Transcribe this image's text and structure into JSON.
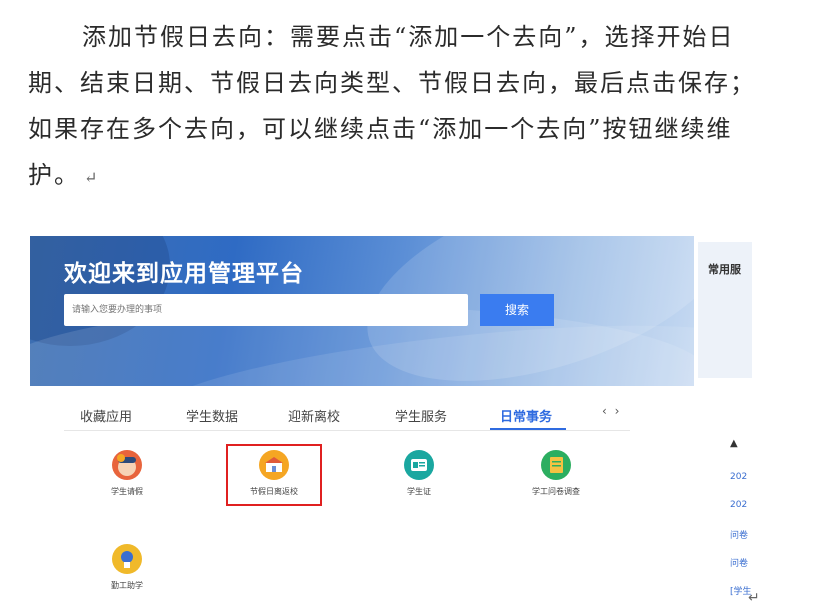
{
  "document": {
    "paragraph_lines": [
      "添加节假日去向：需要点击“添加一个去向”，选择开始日",
      "期、结束日期、节假日去向类型、节假日去向，最后点击保存；",
      "如果存在多个去向，可以继续点击“添加一个去向”按钮继续维",
      "护。"
    ],
    "return_mark": "↵"
  },
  "screenshot": {
    "banner_title": "欢迎来到应用管理平台",
    "search_placeholder": "请输入您要办理的事项",
    "search_button": "搜索",
    "side_panel_title": "常用服",
    "tabs": [
      "收藏应用",
      "学生数据",
      "迎新离校",
      "学生服务",
      "日常事务"
    ],
    "active_tab": "日常事务",
    "tab_arrows": "‹ ›",
    "apps": [
      {
        "label": "学生请假",
        "color": "#e8643c"
      },
      {
        "label": "节假日离返校",
        "color": "#f5a623",
        "highlighted": true
      },
      {
        "label": "学生证",
        "color": "#1aa7a0"
      },
      {
        "label": "学工问卷调查",
        "color": "#2cae60"
      },
      {
        "label": "勤工助学",
        "color": "#f0b92a"
      }
    ],
    "notices": {
      "icon": "megaphone-icon",
      "items": [
        "202",
        "202",
        "问卷",
        "问卷",
        "[学生"
      ]
    },
    "return_mark": "↵"
  }
}
